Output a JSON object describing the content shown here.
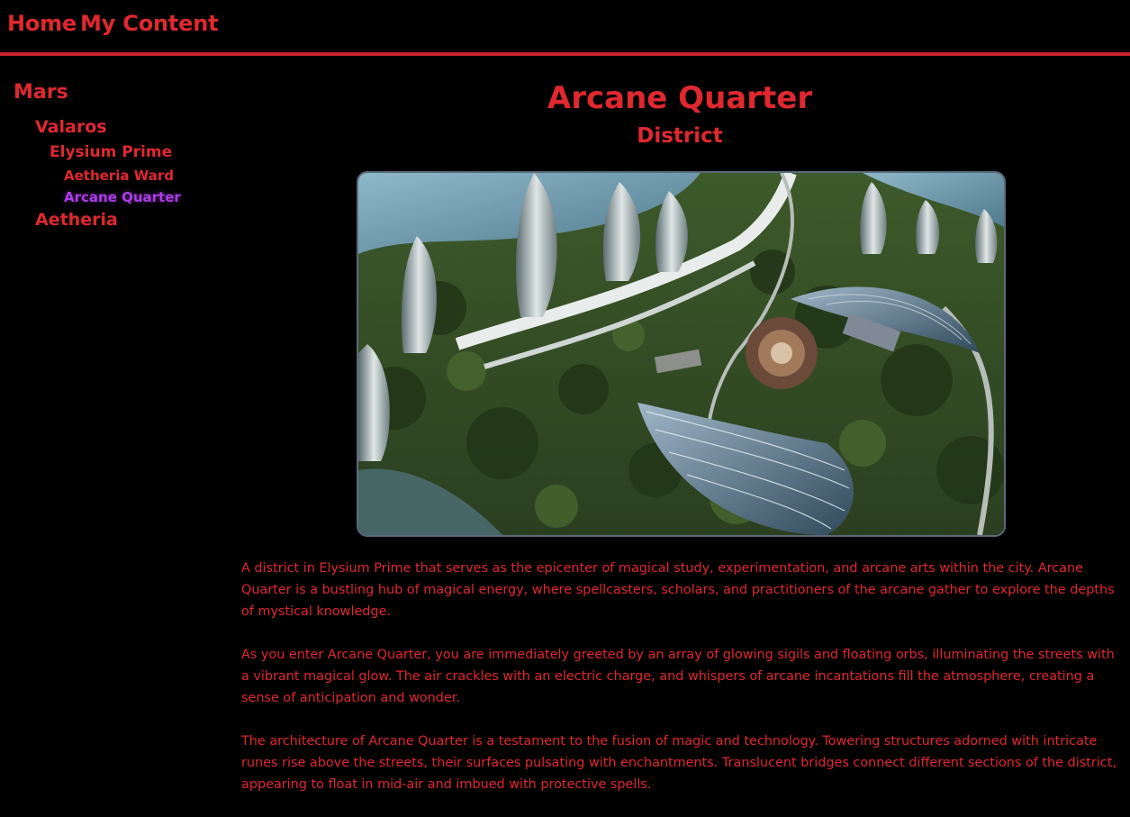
{
  "nav": {
    "home": "Home",
    "my_content": "My Content"
  },
  "sidebar": {
    "tree": [
      {
        "label": "Mars",
        "level": 0
      },
      {
        "label": "Valaros",
        "level": 1
      },
      {
        "label": "Elysium Prime",
        "level": 2
      },
      {
        "label": "Aetheria Ward",
        "level": 3
      },
      {
        "label": "Arcane Quarter",
        "level": 3,
        "selected": true
      },
      {
        "label": "Aetheria",
        "level": 1
      }
    ]
  },
  "main": {
    "title": "Arcane Quarter",
    "subtitle": "District",
    "image_alt": "Aerial view of futuristic city district with towers and glass domes",
    "paragraphs": [
      "A district in Elysium Prime that serves as the epicenter of magical study, experimentation, and arcane arts within the city. Arcane Quarter is a bustling hub of magical energy, where spellcasters, scholars, and practitioners of the arcane gather to explore the depths of mystical knowledge.",
      "As you enter Arcane Quarter, you are immediately greeted by an array of glowing sigils and floating orbs, illuminating the streets with a vibrant magical glow. The air crackles with an electric charge, and whispers of arcane incantations fill the atmosphere, creating a sense of anticipation and wonder.",
      "The architecture of Arcane Quarter is a testament to the fusion of magic and technology. Towering structures adorned with intricate runes rise above the streets, their surfaces pulsating with enchantments. Translucent bridges connect different sections of the district, appearing to float in mid-air and imbued with protective spells."
    ]
  },
  "colors": {
    "background": "#000000",
    "text": "#e0282f",
    "selected": "#a93ee6",
    "divider": "#c8232b"
  }
}
